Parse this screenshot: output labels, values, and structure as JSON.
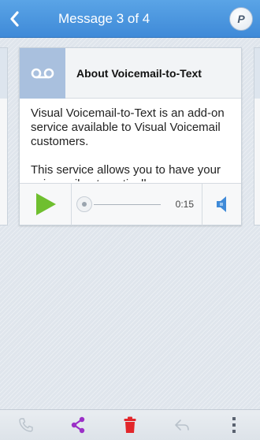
{
  "header": {
    "title": "Message 3 of 4",
    "back_icon": "chevron-left-icon",
    "menu_icon": "profile-badge-icon",
    "menu_badge_text": "P"
  },
  "message": {
    "title": "About Voicemail-to-Text",
    "icon": "voicemail-icon",
    "body": [
      "Visual Voicemail-to-Text is an add-on service available to Visual Voicemail customers.",
      "This service allows you to have your voicemail automatically"
    ]
  },
  "player": {
    "play_icon": "play-icon",
    "time": "0:15",
    "volume_icon": "speaker-icon",
    "progress": 0
  },
  "bottom_bar": {
    "icons": [
      "phone-icon",
      "share-icon",
      "trash-icon",
      "reply-icon",
      "overflow-menu-icon"
    ]
  },
  "colors": {
    "header": "#4a97df",
    "play": "#6fbf2f",
    "share": "#9b2fc7",
    "delete": "#e2262a"
  }
}
